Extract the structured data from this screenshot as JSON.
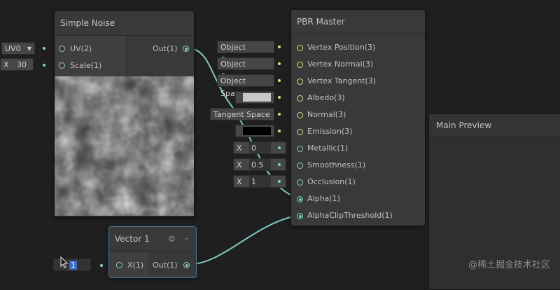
{
  "simple_noise": {
    "title": "Simple Noise",
    "port_uv": "UV(2)",
    "port_scale": "Scale(1)",
    "port_out": "Out(1)",
    "uv_dropdown": "UV0",
    "scale_prefix": "X",
    "scale_value": "30"
  },
  "pbr_master": {
    "title": "PBR Master",
    "ports": [
      {
        "label": "Vertex Position(3)",
        "input": "Object Space"
      },
      {
        "label": "Vertex Normal(3)",
        "input": "Object Space"
      },
      {
        "label": "Vertex Tangent(3)",
        "input": "Object Space"
      },
      {
        "label": "Albedo(3)",
        "input": ""
      },
      {
        "label": "Normal(3)",
        "input": "Tangent Space"
      },
      {
        "label": "Emission(3)",
        "input": ""
      },
      {
        "label": "Metallic(1)",
        "input": "0"
      },
      {
        "label": "Smoothness(1)",
        "input": "0.5"
      },
      {
        "label": "Occlusion(1)",
        "input": "1"
      },
      {
        "label": "Alpha(1)",
        "input": ""
      },
      {
        "label": "AlphaClipThreshold(1)",
        "input": ""
      }
    ],
    "field_prefix": "X"
  },
  "vector1": {
    "title": "Vector 1",
    "port_x": "X(1)",
    "port_out": "Out(1)",
    "input_value": "1"
  },
  "main_preview": {
    "title": "Main Preview"
  },
  "watermark": "@稀土掘金技术社区",
  "colors": {
    "albedo_swatch": "#c8c8c8",
    "emission_swatch": "#000000",
    "wire": "#7ec9c4"
  }
}
